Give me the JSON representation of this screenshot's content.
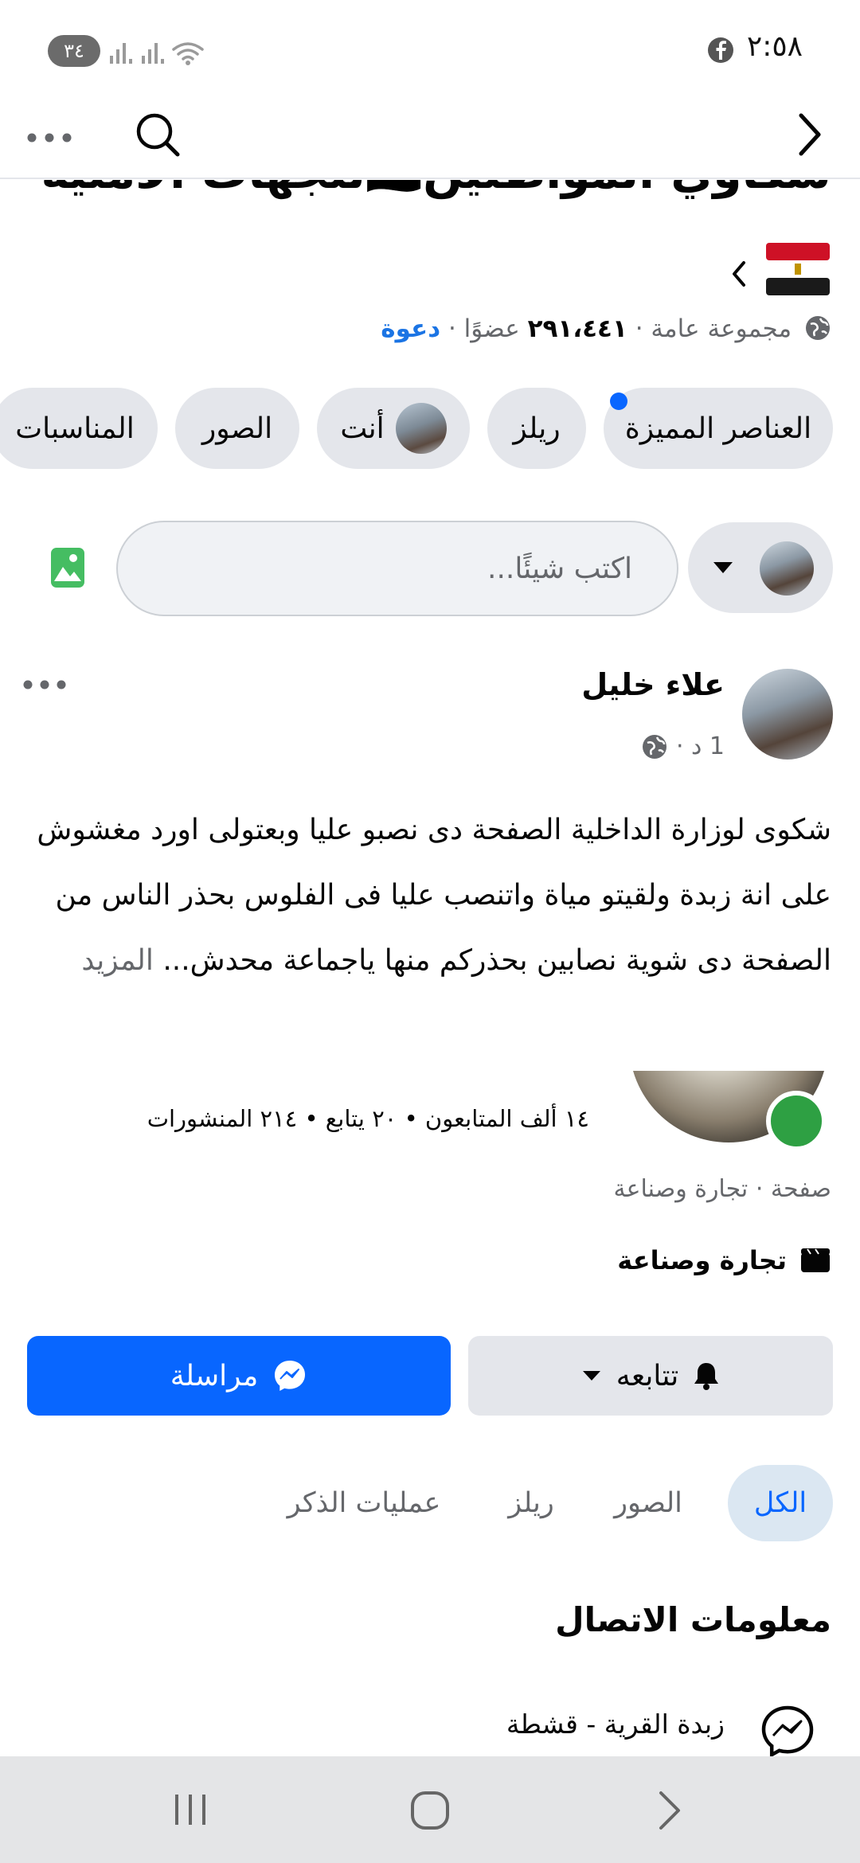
{
  "status_bar": {
    "time": "٢:٥٨",
    "battery": "٣٤"
  },
  "group": {
    "title": "شكاوي المواطنين🇪🇬للجهات الأمنية",
    "meta_prefix": "مجموعة عامة · ",
    "members_count": "٢٩١،٤٤١",
    "members_suffix": " عضوًا · ",
    "invite": "دعوة"
  },
  "chips": [
    {
      "label": "العناصر المميزة"
    },
    {
      "label": "ريلز"
    },
    {
      "label": "أنت"
    },
    {
      "label": "الصور"
    },
    {
      "label": "المناسبات"
    }
  ],
  "composer": {
    "placeholder": "اكتب شيئًا..."
  },
  "post": {
    "author": "علاء خليل",
    "time": "1 د · ",
    "text": "شكوى لوزارة الداخلية الصفحة دى نصبو عليا وبعتولى اورد مغشوش على انة زبدة ولقيتو مياة واتنصب عليا فى الفلوس بحذر الناس من الصفحة دى شوية نصابين بحذركم منها ياجماعة محدش... ",
    "more": "المزيد"
  },
  "shared_page": {
    "stats": "١٤ ألف المتابعون • ٢٠ يتابع • ٢١٤ المنشورات",
    "type": "صفحة · تجارة وصناعة",
    "category": "تجارة وصناعة",
    "follow_label": "تتابعه",
    "message_label": "مراسلة"
  },
  "tabs": [
    {
      "label": "الكل"
    },
    {
      "label": "الصور"
    },
    {
      "label": "ريلز"
    },
    {
      "label": "عمليات الذكر"
    }
  ],
  "contact": {
    "title": "معلومات الاتصال",
    "messenger_name": "زبدة القرية - قشطة"
  },
  "colors": {
    "accent": "#0866ff",
    "chip_bg": "#e4e6eb",
    "online": "#2ea043"
  }
}
